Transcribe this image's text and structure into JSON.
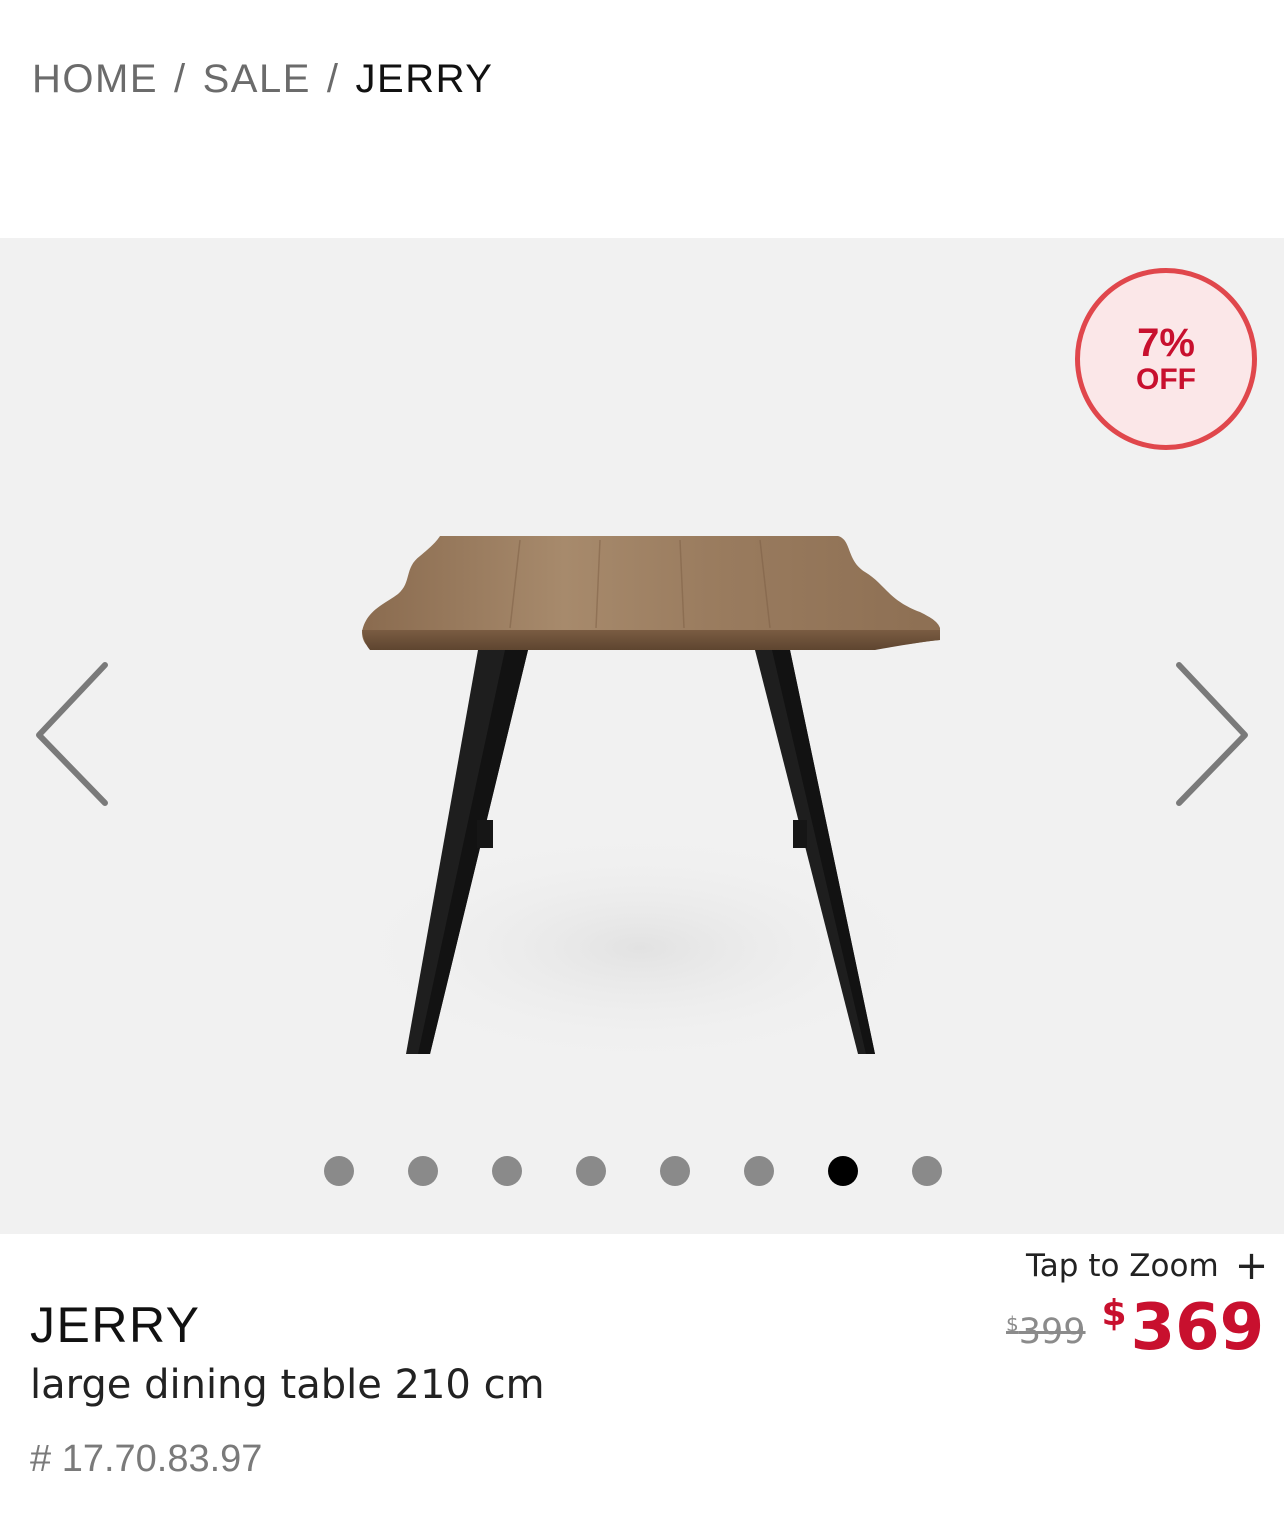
{
  "breadcrumb": {
    "items": [
      "HOME",
      "SALE",
      "JERRY"
    ],
    "separator": "/"
  },
  "gallery": {
    "image": "product-photo",
    "slide_count": 8,
    "active_slide": 7,
    "prev_icon": "chevron-left-icon",
    "next_icon": "chevron-right-icon"
  },
  "badge": {
    "percent": "7%",
    "label": "OFF",
    "color": "#c8102e"
  },
  "zoom": {
    "label": "Tap to Zoom",
    "icon": "+"
  },
  "price": {
    "currency": "$",
    "old": "399",
    "new": "369",
    "accent": "#c8102e"
  },
  "product": {
    "name": "JERRY",
    "description": "large dining table 210 cm",
    "sku": "# 17.70.83.97"
  }
}
